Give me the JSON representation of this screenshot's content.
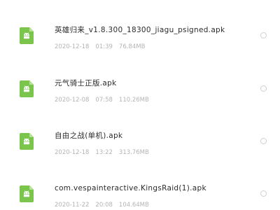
{
  "files": [
    {
      "name": "英雄归来_v1.8.300_18300_jiagu_psigned.apk",
      "date": "2020-12-18",
      "time": "01:39",
      "size": "76.84MB",
      "icon": "apk-file-icon"
    },
    {
      "name": "元气骑士正版.apk",
      "date": "2020-12-08",
      "time": "07:58",
      "size": "110.26MB",
      "icon": "apk-file-icon"
    },
    {
      "name": "自由之战(单机).apk",
      "date": "2020-12-18",
      "time": "13:22",
      "size": "313.76MB",
      "icon": "apk-file-icon"
    },
    {
      "name": "com.vespainteractive.KingsRaid(1).apk",
      "date": "2020-11-22",
      "time": "20:08",
      "size": "104.64MB",
      "icon": "apk-file-icon"
    }
  ],
  "colors": {
    "icon_green": "#7cc54d",
    "name_text": "#2b2b2b",
    "meta_text": "#b4b4b4",
    "radio_border": "#d0d0d0"
  }
}
